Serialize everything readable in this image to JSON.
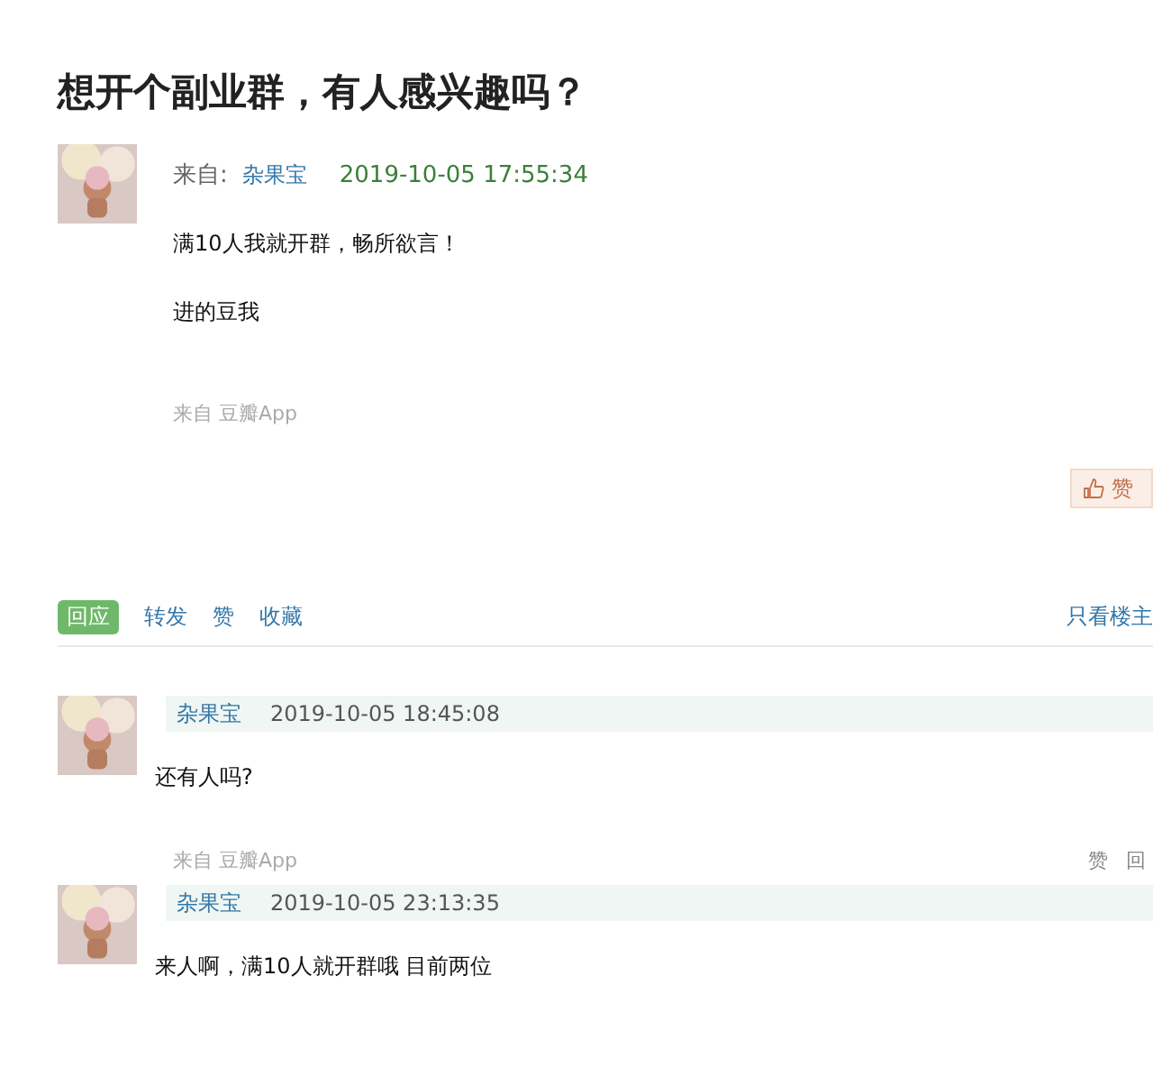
{
  "title": "想开个副业群，有人感兴趣吗？",
  "post": {
    "from_label": "来自:",
    "author": "杂果宝",
    "time": "2019-10-05 17:55:34",
    "paragraphs": [
      "满10人我就开群，畅所欲言！",
      "进的豆我"
    ],
    "source": "来自 豆瓣App",
    "like": "赞"
  },
  "actions": [
    {
      "label": "回应",
      "kind": "primary"
    },
    {
      "label": "转发",
      "kind": "link"
    },
    {
      "label": "赞",
      "kind": "link"
    },
    {
      "label": "收藏",
      "kind": "link"
    }
  ],
  "owner_only": "只看楼主",
  "replies": [
    {
      "author": "杂果宝",
      "time": "2019-10-05 18:45:08",
      "text": "还有人吗?",
      "source": "来自 豆瓣App",
      "links": [
        "赞",
        "回"
      ]
    },
    {
      "author": "杂果宝",
      "time": "2019-10-05 23:13:35",
      "text": "来人啊，满10人就开群哦 目前两位"
    }
  ]
}
